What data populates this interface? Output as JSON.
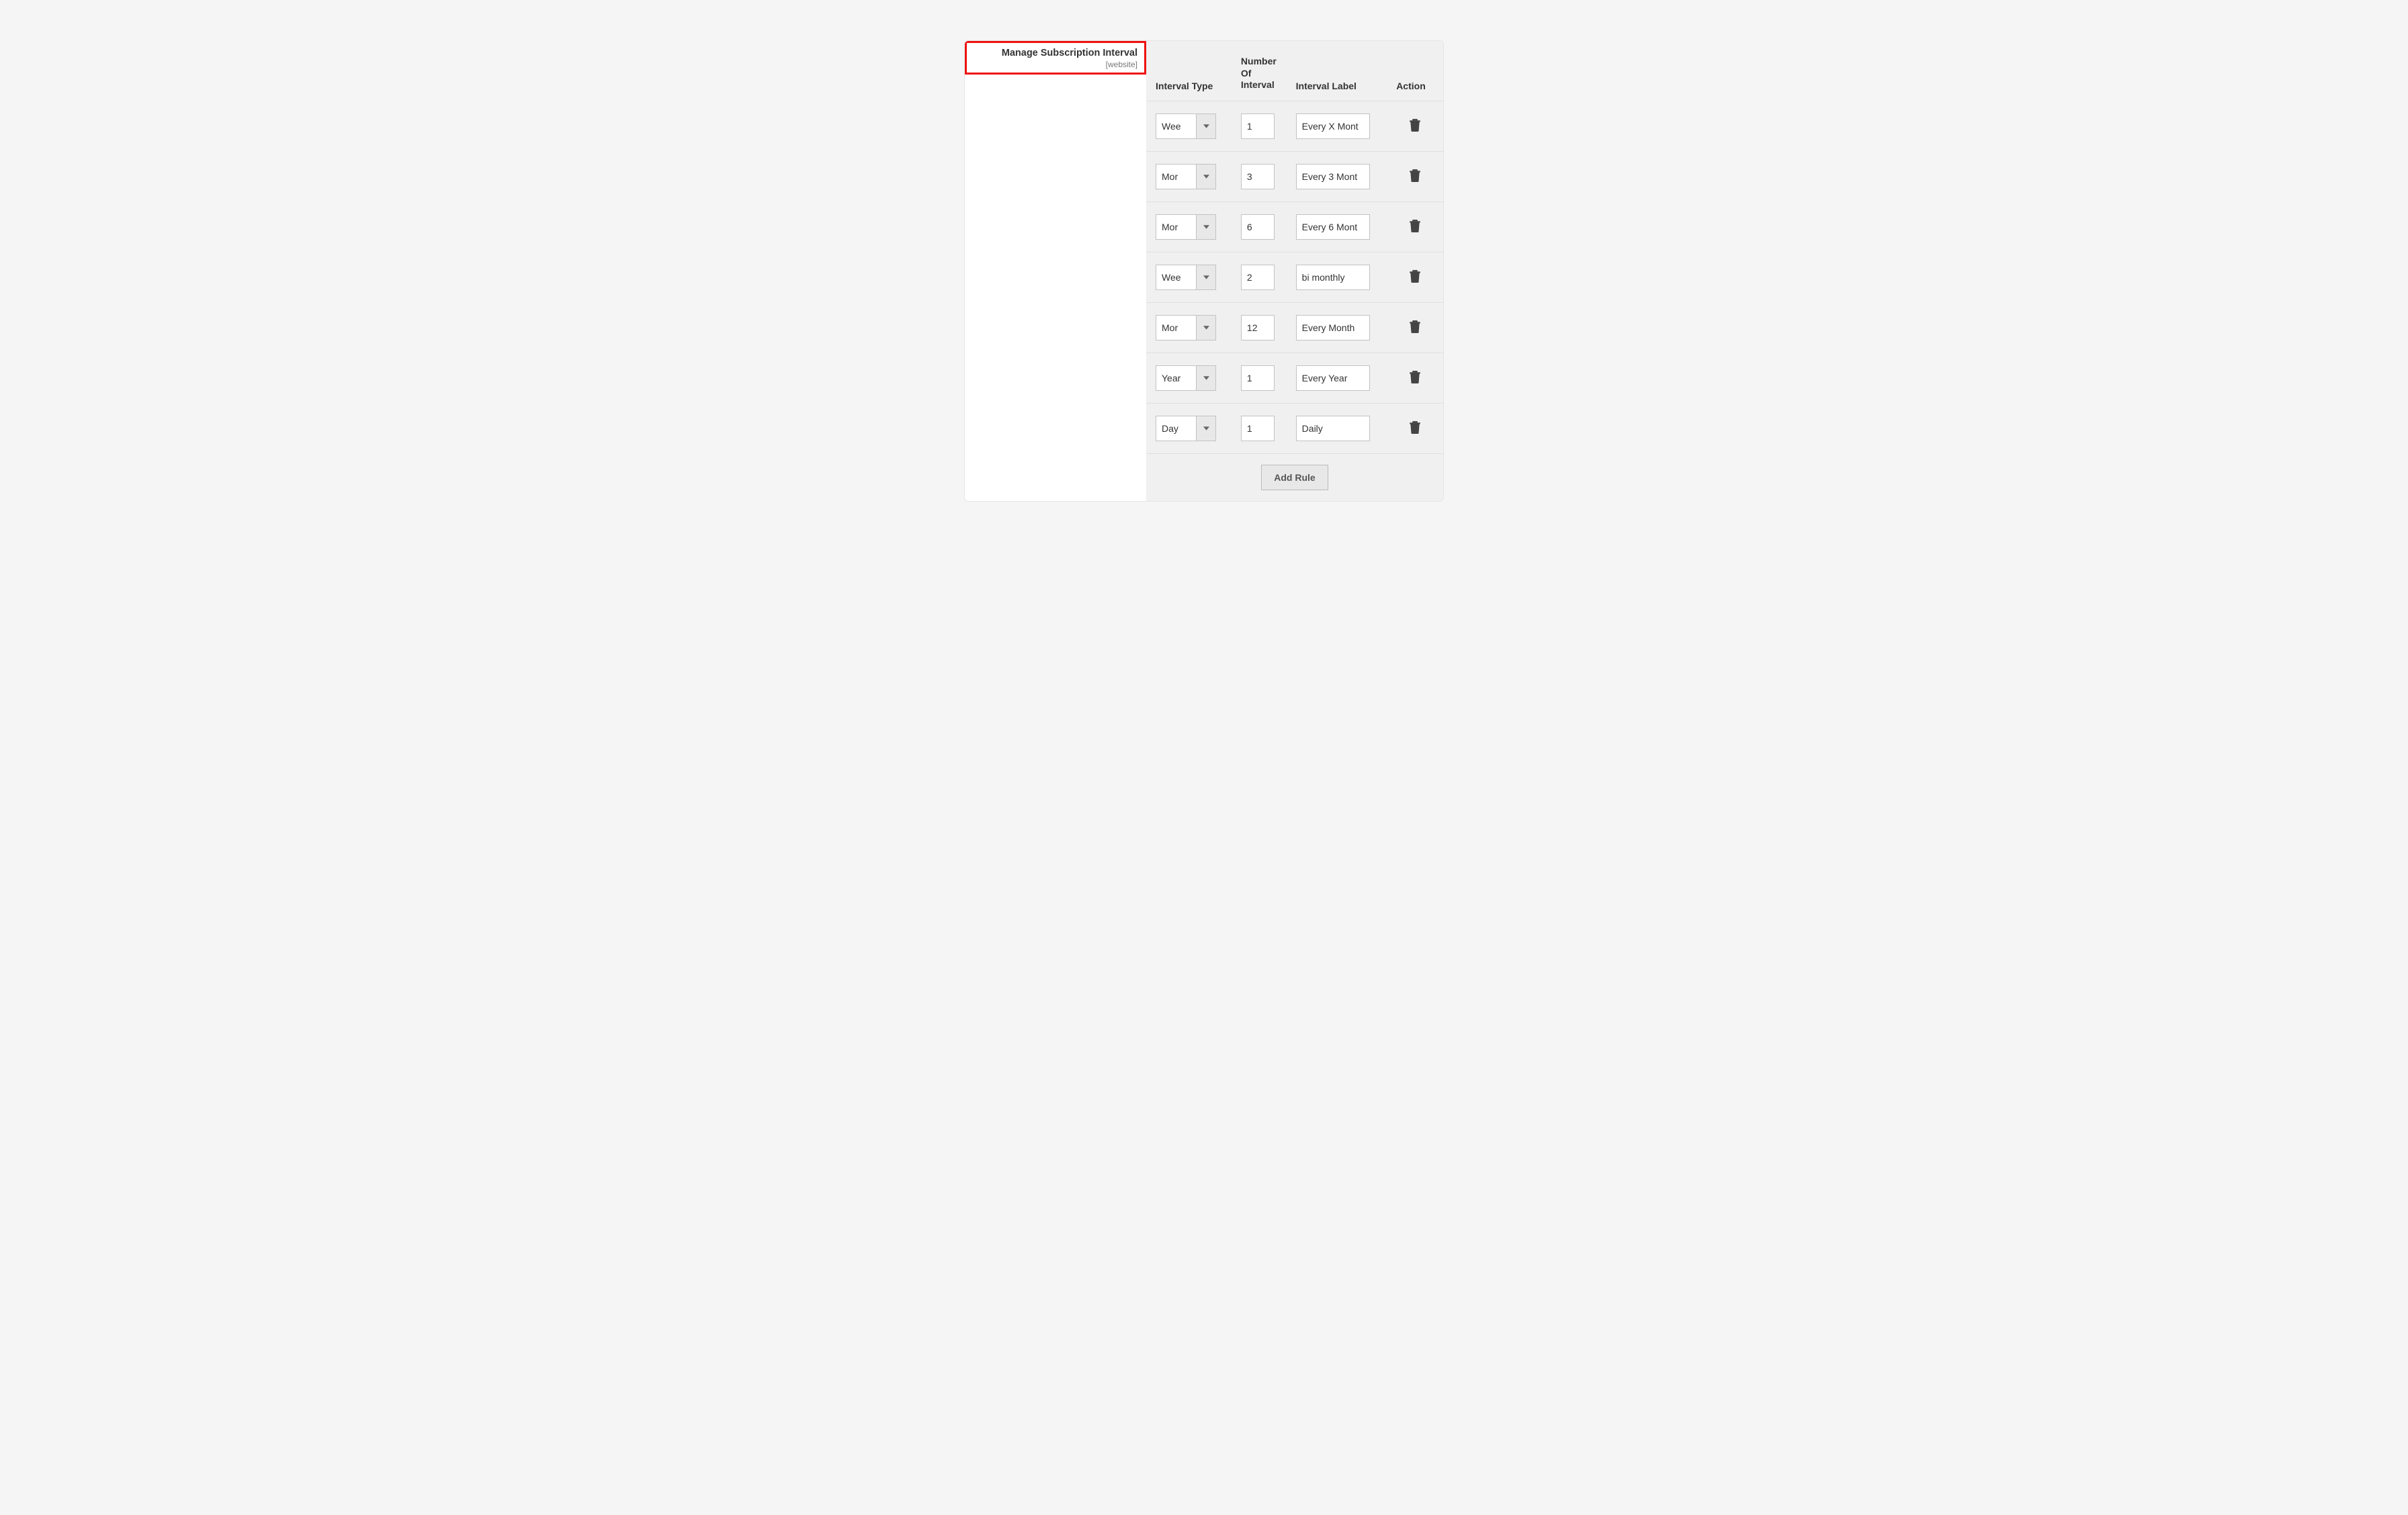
{
  "label": {
    "title": "Manage Subscription Interval",
    "scope": "[website]"
  },
  "table": {
    "headers": {
      "type": "Interval Type",
      "number": "Number Of Interval",
      "label": "Interval Label",
      "action": "Action"
    },
    "rows": [
      {
        "type": "Wee",
        "number": "1",
        "label": "Every X Mont"
      },
      {
        "type": "Mor",
        "number": "3",
        "label": "Every 3 Mont"
      },
      {
        "type": "Mor",
        "number": "6",
        "label": "Every 6 Mont"
      },
      {
        "type": "Wee",
        "number": "2",
        "label": "bi monthly"
      },
      {
        "type": "Mor",
        "number": "12",
        "label": "Every Month"
      },
      {
        "type": "Year",
        "number": "1",
        "label": "Every Year"
      },
      {
        "type": "Day",
        "number": "1",
        "label": "Daily"
      }
    ],
    "add_button": "Add Rule"
  }
}
